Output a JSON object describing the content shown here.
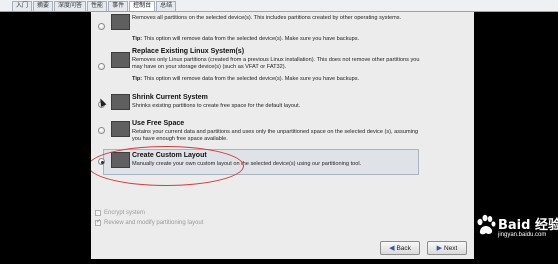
{
  "tabs": [
    "入门",
    "摘要",
    "深度问答",
    "性能",
    "事件",
    "控制台",
    "总结"
  ],
  "active_tab_index": 5,
  "options": [
    {
      "title": "",
      "desc": "Removes all partitions on the selected device(s). This includes partitions created by other operating systems.",
      "tip_label": "Tip:",
      "tip": "This option will remove data from the selected device(s). Make sure you have backups.",
      "selected": false
    },
    {
      "title": "Replace Existing Linux System(s)",
      "desc": "Removes only Linux partitions (created from a previous Linux installation). This does not remove other partitions you may have on your storage device(s) (such as VFAT or FAT32).",
      "tip_label": "Tip:",
      "tip": "This option will remove data from the selected device(s). Make sure you have backups.",
      "selected": false
    },
    {
      "title": "Shrink Current System",
      "desc": "Shrinks existing partitions to create free space for the default layout.",
      "selected": false
    },
    {
      "title": "Use Free Space",
      "desc": "Retains your current data and partitions and uses only the unpartitioned space on the selected device (s), assuming you have enough free space available.",
      "selected": false
    },
    {
      "title": "Create Custom Layout",
      "desc": "Manually create your own custom layout on the selected device(s) using our partitioning tool.",
      "selected": true
    }
  ],
  "checkboxes": {
    "encrypt": {
      "label": "Encrypt system",
      "checked": false
    },
    "review": {
      "label": "Review and modify partitioning layout",
      "checked": true
    }
  },
  "buttons": {
    "back": "Back",
    "next": "Next"
  },
  "watermark": {
    "text": "Baid 经验",
    "url": "jingyan.baidu.com"
  },
  "colors": {
    "highlight": "#dfe3e8",
    "annotation": "#d63b3b"
  }
}
